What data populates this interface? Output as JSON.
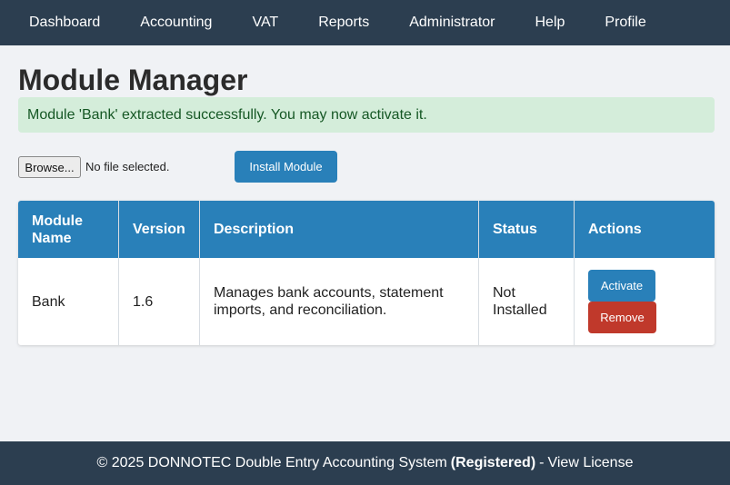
{
  "nav": {
    "items": [
      {
        "label": "Dashboard"
      },
      {
        "label": "Accounting"
      },
      {
        "label": "VAT"
      },
      {
        "label": "Reports"
      },
      {
        "label": "Administrator"
      },
      {
        "label": "Help"
      },
      {
        "label": "Profile"
      }
    ]
  },
  "page": {
    "title": "Module Manager"
  },
  "alert": {
    "message": "Module 'Bank' extracted successfully. You may now activate it."
  },
  "upload": {
    "browse_label": "Browse...",
    "file_status": "No file selected.",
    "install_label": "Install Module"
  },
  "table": {
    "headers": [
      "Module Name",
      "Version",
      "Description",
      "Status",
      "Actions"
    ],
    "rows": [
      {
        "name": "Bank",
        "version": "1.6",
        "description": "Manages bank accounts, statement imports, and reconciliation.",
        "status": "Not Installed",
        "activate_label": "Activate",
        "remove_label": "Remove"
      }
    ]
  },
  "footer": {
    "copyright": "© 2025 DONNOTEC Double Entry Accounting System",
    "registered": "(Registered)",
    "separator": "-",
    "license_link": "View License"
  },
  "colors": {
    "nav_bg": "#2c3e50",
    "primary": "#2980b9",
    "danger": "#c0392b",
    "success_bg": "#d4edda",
    "success_text": "#155724"
  }
}
